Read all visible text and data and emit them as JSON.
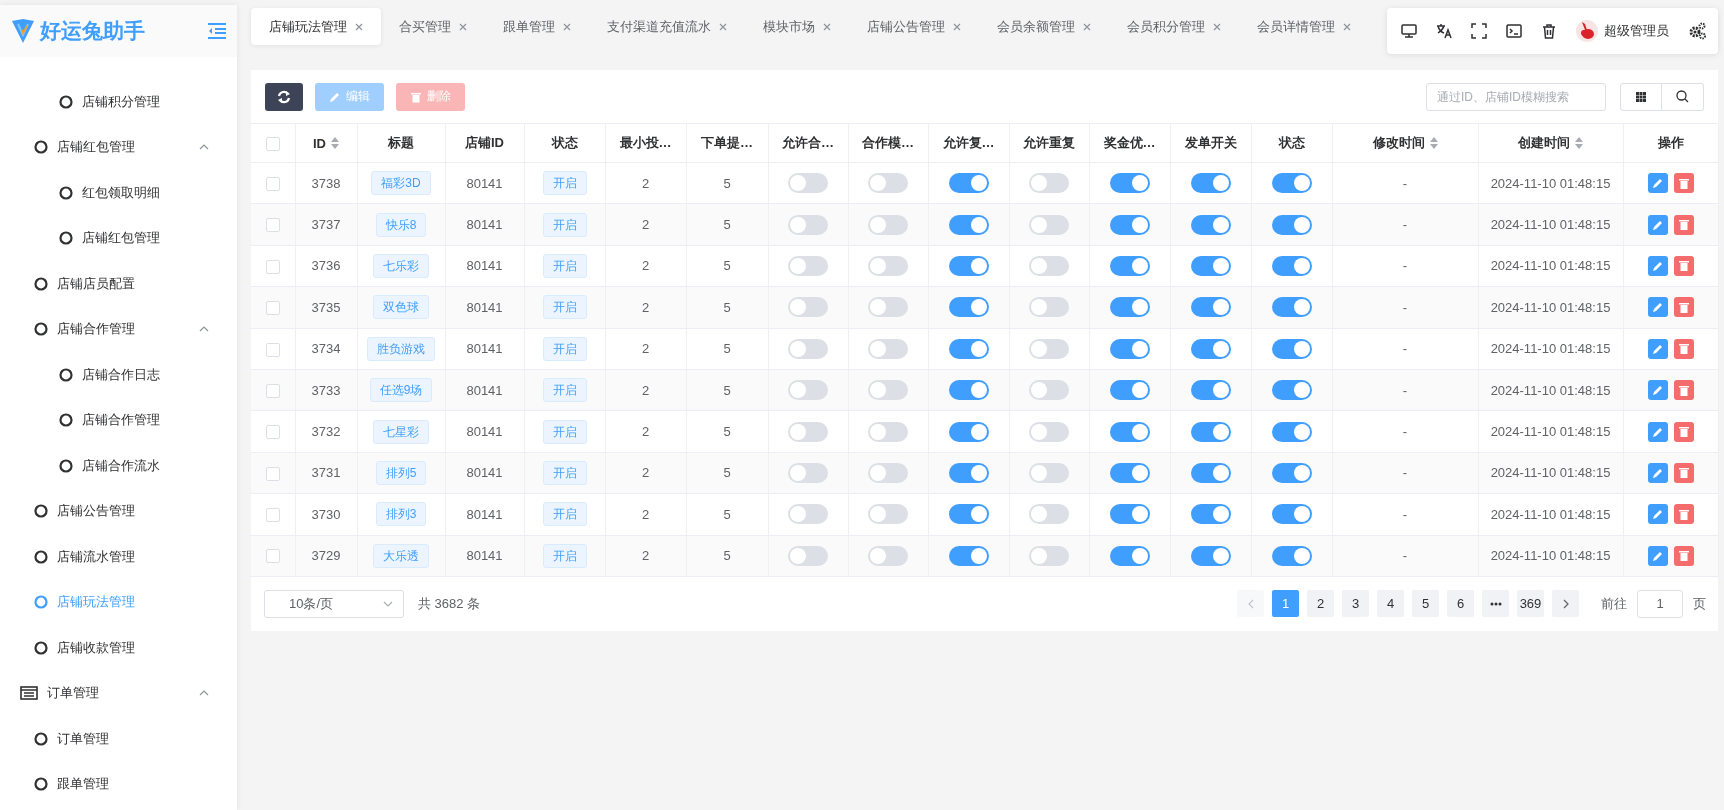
{
  "app": {
    "title": "好运兔助手"
  },
  "sidebar": {
    "items": [
      {
        "children": [
          {
            "children": [
              {
                "label": "店铺积分管理",
                "selected": false
              }
            ]
          },
          {
            "label": "店铺红包管理",
            "selected": false,
            "expanded": true,
            "children": [
              {
                "label": "红包领取明细",
                "selected": false
              },
              {
                "label": "店铺红包管理",
                "selected": false
              }
            ]
          },
          {
            "label": "店铺店员配置",
            "selected": false
          },
          {
            "label": "店铺合作管理",
            "selected": false,
            "expanded": true,
            "children": [
              {
                "label": "店铺合作日志",
                "selected": false
              },
              {
                "label": "店铺合作管理",
                "selected": false
              },
              {
                "label": "店铺合作流水",
                "selected": false
              }
            ]
          },
          {
            "label": "店铺公告管理",
            "selected": false
          },
          {
            "label": "店铺流水管理",
            "selected": false
          },
          {
            "label": "店铺玩法管理",
            "selected": true
          },
          {
            "label": "店铺收款管理",
            "selected": false
          }
        ]
      },
      {
        "label": "订单管理",
        "selected": false,
        "expanded": true,
        "children": [
          {
            "label": "订单管理",
            "selected": false
          },
          {
            "label": "跟单管理",
            "selected": false
          }
        ]
      }
    ]
  },
  "tabs": [
    {
      "label": "店铺玩法管理",
      "selected": true
    },
    {
      "label": "合买管理",
      "selected": false
    },
    {
      "label": "跟单管理",
      "selected": false
    },
    {
      "label": "支付渠道充值流水",
      "selected": false
    },
    {
      "label": "模块市场",
      "selected": false
    },
    {
      "label": "店铺公告管理",
      "selected": false
    },
    {
      "label": "会员余额管理",
      "selected": false
    },
    {
      "label": "会员积分管理",
      "selected": false
    },
    {
      "label": "会员详情管理",
      "selected": false
    }
  ],
  "user": {
    "name": "超级管理员"
  },
  "toolbar": {
    "buttons": [
      {
        "kind": "refresh"
      },
      {
        "kind": "edit",
        "label": "编辑",
        "disabled": true
      },
      {
        "kind": "delete",
        "label": "删除",
        "disabled": true
      }
    ],
    "search": {
      "placeholder": "通过ID、店铺ID模糊搜索"
    }
  },
  "table": {
    "all_checked": false,
    "columns": [
      {
        "label": "ID",
        "sortable": true
      },
      {
        "label": "标题",
        "sortable": false
      },
      {
        "label": "店铺ID",
        "sortable": false
      },
      {
        "label": "状态",
        "sortable": false
      },
      {
        "label": "最小投…",
        "sortable": false
      },
      {
        "label": "下单提…",
        "sortable": false
      },
      {
        "label": "允许合…",
        "sortable": false
      },
      {
        "label": "合作模…",
        "sortable": false
      },
      {
        "label": "允许复…",
        "sortable": false
      },
      {
        "label": "允许重复",
        "sortable": false
      },
      {
        "label": "奖金优…",
        "sortable": false
      },
      {
        "label": "发单开关",
        "sortable": false
      },
      {
        "label": "状态",
        "sortable": false
      },
      {
        "label": "修改时间",
        "sortable": true
      },
      {
        "label": "创建时间",
        "sortable": true
      },
      {
        "label": "操作",
        "sortable": false
      }
    ],
    "rows": [
      {
        "checked": false,
        "id": "3738",
        "title": "福彩3D",
        "shop_id": "80141",
        "status": "开启",
        "min_bet": "2",
        "order_lead": "5",
        "switches": [
          false,
          false,
          true,
          false,
          true,
          true,
          true
        ],
        "modified": "-",
        "created": "2024-11-10 01:48:15"
      },
      {
        "checked": false,
        "id": "3737",
        "title": "快乐8",
        "shop_id": "80141",
        "status": "开启",
        "min_bet": "2",
        "order_lead": "5",
        "switches": [
          false,
          false,
          true,
          false,
          true,
          true,
          true
        ],
        "modified": "-",
        "created": "2024-11-10 01:48:15"
      },
      {
        "checked": false,
        "id": "3736",
        "title": "七乐彩",
        "shop_id": "80141",
        "status": "开启",
        "min_bet": "2",
        "order_lead": "5",
        "switches": [
          false,
          false,
          true,
          false,
          true,
          true,
          true
        ],
        "modified": "-",
        "created": "2024-11-10 01:48:15"
      },
      {
        "checked": false,
        "id": "3735",
        "title": "双色球",
        "shop_id": "80141",
        "status": "开启",
        "min_bet": "2",
        "order_lead": "5",
        "switches": [
          false,
          false,
          true,
          false,
          true,
          true,
          true
        ],
        "modified": "-",
        "created": "2024-11-10 01:48:15"
      },
      {
        "checked": false,
        "id": "3734",
        "title": "胜负游戏",
        "shop_id": "80141",
        "status": "开启",
        "min_bet": "2",
        "order_lead": "5",
        "switches": [
          false,
          false,
          true,
          false,
          true,
          true,
          true
        ],
        "modified": "-",
        "created": "2024-11-10 01:48:15"
      },
      {
        "checked": false,
        "id": "3733",
        "title": "任选9场",
        "shop_id": "80141",
        "status": "开启",
        "min_bet": "2",
        "order_lead": "5",
        "switches": [
          false,
          false,
          true,
          false,
          true,
          true,
          true
        ],
        "modified": "-",
        "created": "2024-11-10 01:48:15"
      },
      {
        "checked": false,
        "id": "3732",
        "title": "七星彩",
        "shop_id": "80141",
        "status": "开启",
        "min_bet": "2",
        "order_lead": "5",
        "switches": [
          false,
          false,
          true,
          false,
          true,
          true,
          true
        ],
        "modified": "-",
        "created": "2024-11-10 01:48:15"
      },
      {
        "checked": false,
        "id": "3731",
        "title": "排列5",
        "shop_id": "80141",
        "status": "开启",
        "min_bet": "2",
        "order_lead": "5",
        "switches": [
          false,
          false,
          true,
          false,
          true,
          true,
          true
        ],
        "modified": "-",
        "created": "2024-11-10 01:48:15"
      },
      {
        "checked": false,
        "id": "3730",
        "title": "排列3",
        "shop_id": "80141",
        "status": "开启",
        "min_bet": "2",
        "order_lead": "5",
        "switches": [
          false,
          false,
          true,
          false,
          true,
          true,
          true
        ],
        "modified": "-",
        "created": "2024-11-10 01:48:15"
      },
      {
        "checked": false,
        "id": "3729",
        "title": "大乐透",
        "shop_id": "80141",
        "status": "开启",
        "min_bet": "2",
        "order_lead": "5",
        "switches": [
          false,
          false,
          true,
          false,
          true,
          true,
          true
        ],
        "modified": "-",
        "created": "2024-11-10 01:48:15"
      }
    ]
  },
  "pagination": {
    "page_size": "10条/页",
    "total": "共 3682 条",
    "pages": [
      {
        "kind": "prev",
        "disabled": true
      },
      {
        "kind": "page",
        "label": "1",
        "selected": true
      },
      {
        "kind": "page",
        "label": "2",
        "selected": false
      },
      {
        "kind": "page",
        "label": "3",
        "selected": false
      },
      {
        "kind": "page",
        "label": "4",
        "selected": false
      },
      {
        "kind": "page",
        "label": "5",
        "selected": false
      },
      {
        "kind": "page",
        "label": "6",
        "selected": false
      },
      {
        "kind": "more"
      },
      {
        "kind": "page",
        "label": "369",
        "selected": false
      },
      {
        "kind": "next",
        "disabled": false
      }
    ],
    "goto": {
      "label": "前往",
      "value": "1",
      "suffix": "页"
    }
  }
}
